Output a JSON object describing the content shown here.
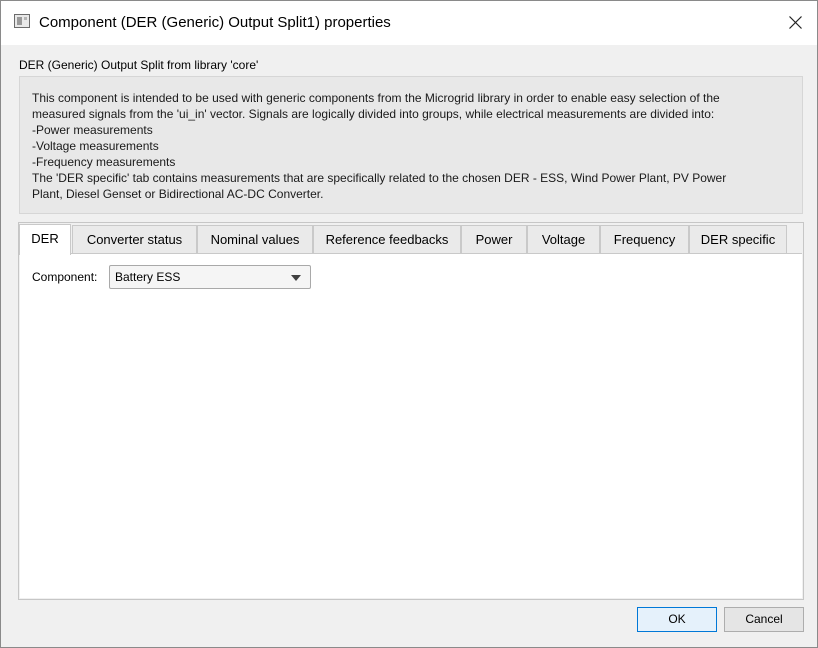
{
  "window": {
    "title": "Component (DER (Generic) Output Split1) properties"
  },
  "library_label": "DER (Generic) Output Split from library 'core'",
  "description": {
    "lines": [
      "This component is intended to be used with generic components from the Microgrid library in order to enable easy selection of the",
      "measured signals from the 'ui_in' vector. Signals are logically divided into groups, while electrical measurements are divided into:",
      "-Power measurements",
      "-Voltage measurements",
      "-Frequency measurements",
      "The 'DER specific' tab contains measurements that are specifically related to the chosen DER - ESS, Wind Power Plant, PV Power",
      "Plant, Diesel Genset or Bidirectional AC-DC Converter."
    ]
  },
  "tabs": [
    {
      "label": "DER",
      "active": true
    },
    {
      "label": "Converter status",
      "active": false
    },
    {
      "label": "Nominal values",
      "active": false
    },
    {
      "label": "Reference feedbacks",
      "active": false
    },
    {
      "label": "Power",
      "active": false
    },
    {
      "label": "Voltage",
      "active": false
    },
    {
      "label": "Frequency",
      "active": false
    },
    {
      "label": "DER specific",
      "active": false
    }
  ],
  "der_tab": {
    "component_label": "Component:",
    "component_value": "Battery ESS"
  },
  "buttons": {
    "ok": "OK",
    "cancel": "Cancel"
  },
  "colors": {
    "default_button_border": "#0078d7",
    "default_button_fill": "#e5f1fb",
    "description_fill": "#e8e8e8"
  }
}
